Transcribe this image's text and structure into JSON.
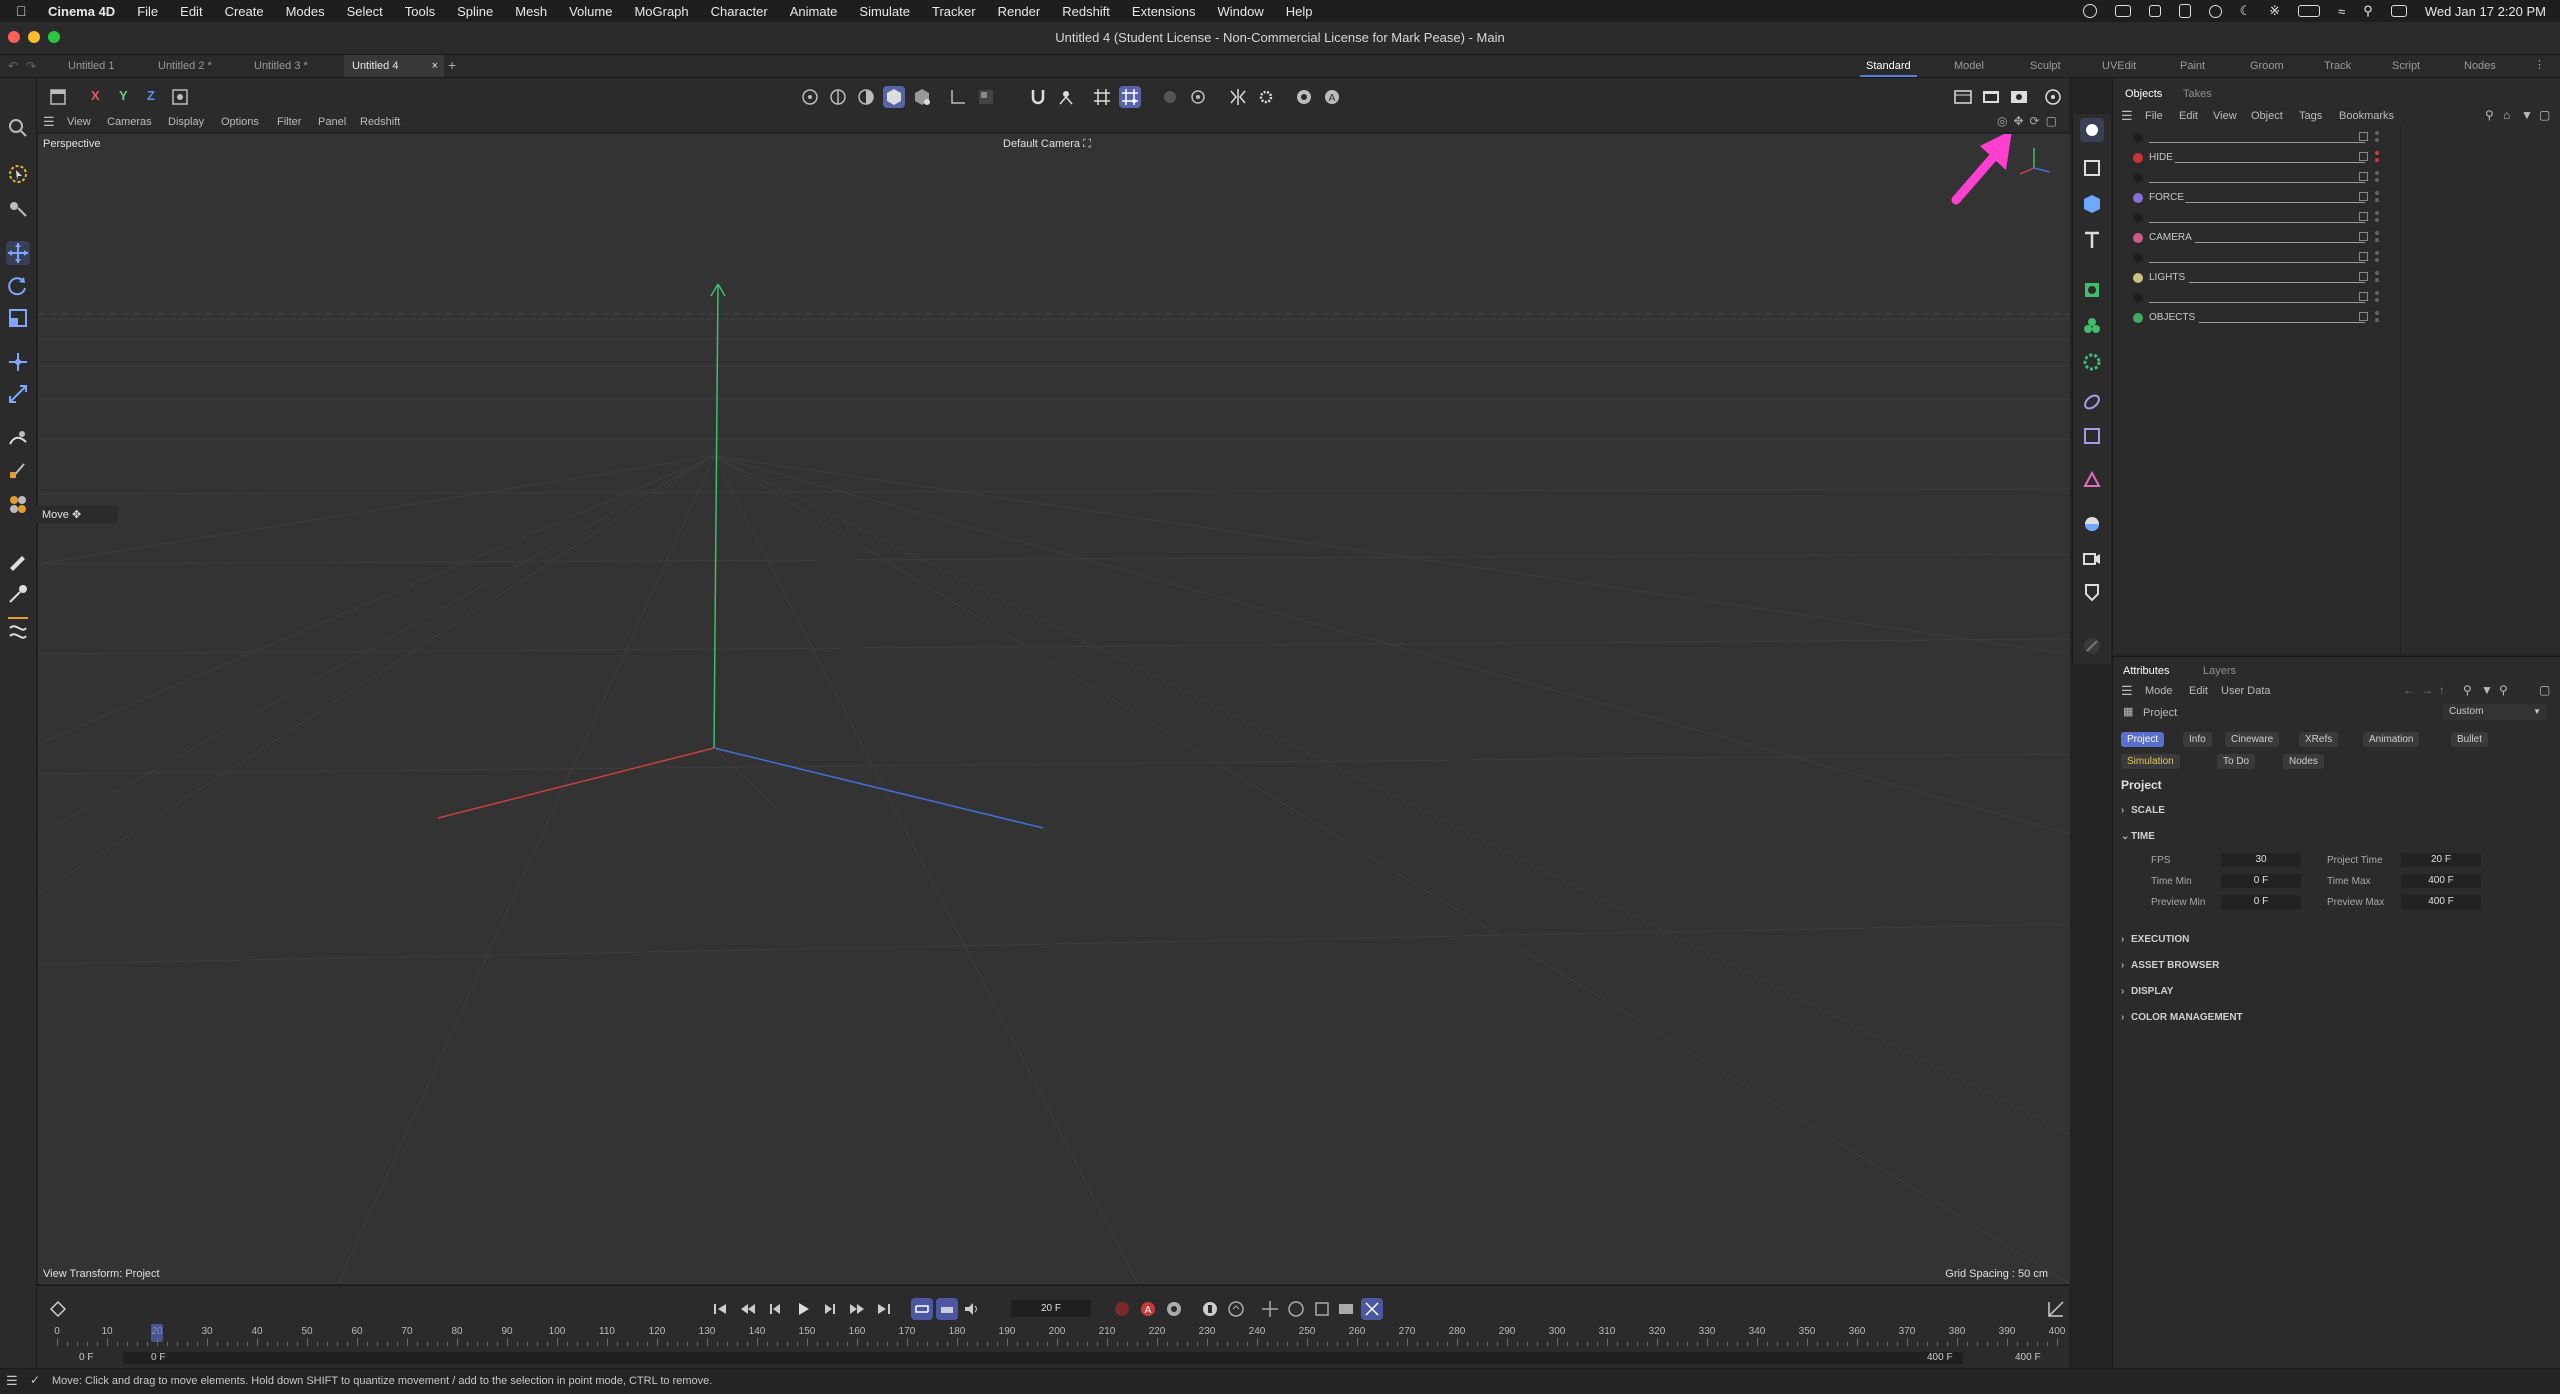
{
  "menubar": {
    "app": "Cinema 4D",
    "items": [
      "File",
      "Edit",
      "Create",
      "Modes",
      "Select",
      "Tools",
      "Spline",
      "Mesh",
      "Volume",
      "MoGraph",
      "Character",
      "Animate",
      "Simulate",
      "Tracker",
      "Render",
      "Redshift",
      "Extensions",
      "Window",
      "Help"
    ],
    "clock": "Wed Jan 17  2:20 PM"
  },
  "window": {
    "title": "Untitled 4 (Student License - Non-Commercial License for Mark Pease) - Main"
  },
  "doc_tabs": [
    "Untitled 1",
    "Untitled 2 *",
    "Untitled 3 *",
    "Untitled 4"
  ],
  "layout_tabs": [
    "Standard",
    "Model",
    "Sculpt",
    "UVEdit",
    "Paint",
    "Groom",
    "Track",
    "Script",
    "Nodes"
  ],
  "axis_labels": {
    "x": "X",
    "y": "Y",
    "z": "Z"
  },
  "viewport": {
    "menu": [
      "View",
      "Cameras",
      "Display",
      "Options",
      "Filter",
      "Panel",
      "Redshift"
    ],
    "projection": "Perspective",
    "camera": "Default Camera",
    "view_transform": "View Transform: Project",
    "grid_spacing": "Grid Spacing : 50 cm",
    "tool_tip": "Move"
  },
  "objects_panel": {
    "tabs": [
      "Objects",
      "Takes"
    ],
    "menu": [
      "File",
      "Edit",
      "View",
      "Object",
      "Tags",
      "Bookmarks"
    ],
    "rows": [
      {
        "name": "",
        "color": "#222222"
      },
      {
        "name": "HIDE",
        "color": "#cc3333"
      },
      {
        "name": "",
        "color": "#222222"
      },
      {
        "name": "FORCE",
        "color": "#8a6fd6"
      },
      {
        "name": "",
        "color": "#222222"
      },
      {
        "name": "CAMERA",
        "color": "#d05a8a"
      },
      {
        "name": "",
        "color": "#222222"
      },
      {
        "name": "LIGHTS",
        "color": "#c8c27a"
      },
      {
        "name": "",
        "color": "#222222"
      },
      {
        "name": "OBJECTS",
        "color": "#3fae5c"
      }
    ]
  },
  "attributes": {
    "tabs": [
      "Attributes",
      "Layers"
    ],
    "menu": [
      "Mode",
      "Edit",
      "User Data"
    ],
    "object": "Project",
    "preset": "Custom",
    "chips": [
      "Project",
      "Info",
      "Cineware",
      "XRefs",
      "Animation",
      "Bullet",
      "Simulation",
      "To Do",
      "Nodes"
    ],
    "heading": "Project",
    "sections": [
      "SCALE",
      "TIME",
      "EXECUTION",
      "ASSET BROWSER",
      "DISPLAY",
      "COLOR MANAGEMENT"
    ],
    "fields": {
      "fps_label": "FPS",
      "fps": "30",
      "project_time_label": "Project Time",
      "project_time": "20 F",
      "time_min_label": "Time Min",
      "time_min": "0 F",
      "time_max_label": "Time Max",
      "time_max": "400 F",
      "preview_min_label": "Preview Min",
      "preview_min": "0 F",
      "preview_max_label": "Preview Max",
      "preview_max": "400 F"
    }
  },
  "timeline": {
    "current_frame": "20 F",
    "ruler": [
      0,
      10,
      20,
      30,
      40,
      50,
      60,
      70,
      80,
      90,
      100,
      110,
      120,
      130,
      140,
      150,
      160,
      170,
      180,
      190,
      200,
      210,
      220,
      230,
      240,
      250,
      260,
      270,
      280,
      290,
      300,
      310,
      320,
      330,
      340,
      350,
      360,
      370,
      380,
      390,
      400
    ],
    "start": "0 F",
    "preview_start": "0 F",
    "preview_end": "400 F",
    "end": "400 F",
    "playhead": 20
  },
  "status": "Move: Click and drag to move elements. Hold down SHIFT to quantize movement / add to the selection in point mode, CTRL to remove.",
  "colors": {
    "accent": "#5a6fcf",
    "annotation_arrow": "#ff3fd0"
  }
}
